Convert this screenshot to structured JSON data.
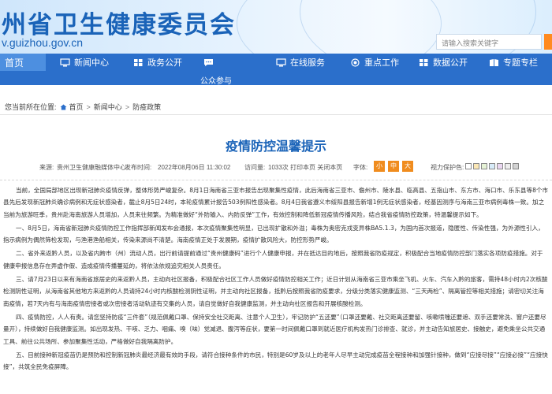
{
  "header": {
    "title": "州省卫生健康委员会",
    "url": "v.guizhou.gov.cn",
    "search_placeholder": "请输入搜索关键字"
  },
  "nav": {
    "home": "首页",
    "items": [
      "新闻中心",
      "政务公开",
      "",
      "在线服务",
      "重点工作",
      "数据公开",
      "专题专栏"
    ],
    "sub": "公众参与"
  },
  "breadcrumb": {
    "prefix": "您当前所在位置:",
    "items": [
      "首页",
      "新闻中心",
      "防疫政策"
    ]
  },
  "article": {
    "title": "疫情防控温馨提示",
    "source": "来源:",
    "source_value": "贵州卫生健康融媒体中心",
    "published": "发布时间:",
    "published_value": "2022年08月06日 11:30:02",
    "visits": "访问量:",
    "visits_value": "1033次",
    "actions": "打印本页 关闭本页",
    "font_label": "字体:",
    "font_sizes": [
      "小",
      "中",
      "大"
    ],
    "eye_label": "视力保护色:",
    "eye_colors": [
      "#ffffff",
      "#fbe7b5",
      "#e6f3d6",
      "#d7ebf9",
      "#ead7f1",
      "#eeeeee",
      "#d3d3d3"
    ],
    "paragraphs": [
      "当前，全国局部地区出现新冠肺炎疫情反弹，整体形势严峻复杂。8月1日海南省三亚市报告出现聚集性疫情，此后海南省三亚市、儋州市、陵水县、临高县、五指山市、东方市、海口市、乐东县等8个市县先后发现新冠肺炎确诊病例和无症状感染者，截止8月5日24时，本轮疫情累计报告503例阳性感染者。8月4日我省遵义市绥阳县报告新增1例无症状感染者，经基因测序与海南三亚市病例毒株一致。加之当前为旅游旺季，贵州赴海南旅游人员增加，人员来往频繁。为精准做好“外防输入、内防反弹”工作，有效控制和降低新冠疫情传播风险，结合我省疫情防控政策，特温馨提示如下。",
      "一、8月5日，海南省新冠肺炎疫情防控工作指挥部新闻发布会通报，本次疫情聚集性明显，已出现扩散和外溢；毒株为奥密克戎变异株BA5.1.3，为国内首次报道，隐匿性、传染性强，为外源性引入，指示病例为偶然筛检发现，与渔港渔船相关，传染来源尚不清楚。海南疫情正处于发展期，疫情扩散风险大，防控形势严峻。",
      "二、省外来返黔人员，以及省内跨市（州）流动人员，出行前请提前通过“贵州健康码”进行个人健康申报，并在抵达目的地后，按照我省防疫规定，积极配合当地疫情防控部门落实各项防疫措施。对于健康申报信息存在弄虚作假、造成疫情传播蔓延的，将依法依规追究相关人员责任。",
      "三、请7月23日以来有海南省旅居史的来返黔人员，主动向社区报备，积极配合社区工作人员做好疫情防控相关工作；近日计划从海南省三亚市乘坐飞机、火车、汽车入黔的旅客，需持48小时内2次核酸检测阴性证明，从海南省其他地方来返黔的人员请持24小时内核酸检测阴性证明，并主动向社区报备，抵黔后按照我省防疫要求，分级分类落实健康监测、“三天两检”、隔离管控等相关措施；请密切关注海南疫情，若7天内有与海南疫情密接者或次密接者活动轨迹有交集的人员，请自觉做好自我健康监测，并主动向社区报告和开展核酸检测。",
      "四、疫情防控，人人有责。请您坚持防疫“三件套”（规范佩戴口罩、保持安全社交距离、注意个人卫生），牢记防护“五还要”（口罩还要戴、社交距离还要留、咳嗽喷嚏还要遮、双手还要常洗、窗户还要尽量开），持续做好自我健康监测。如出现发热、干咳、乏力、咽痛、嗅（味）觉减退、腹泻等症状，要第一时间佩戴口罩到就近医疗机构发热门诊排查、就诊，并主动告知旅居史、接触史，避免乘坐公共交通工具、前往公共场所、参加聚集性活动，严格做好自我隔离防护。",
      "五、目前接种新冠疫苗仍是预防和控制新冠肺炎最经济最有效的手段，请符合接种条件的市民，特别是60岁及以上的老年人尽早主动完成疫苗全程接种和加强针接种，做到“应接尽接”“应接必接”“应接快接”，共筑全民免疫屏障。"
    ]
  },
  "colors": {
    "brand_blue": "#1a63b8",
    "nav_blue": "#2b6fcb",
    "accent_orange": "#f08c1e"
  }
}
